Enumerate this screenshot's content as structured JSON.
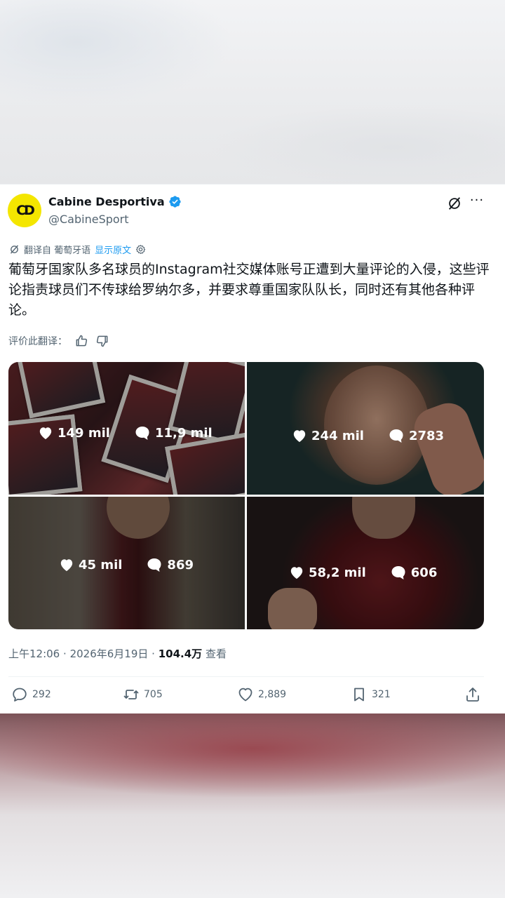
{
  "tweet": {
    "author_name": "Cabine Desportiva",
    "author_handle": "@CabineSport",
    "avatar_text": "CD",
    "verified": true,
    "translated_from": "翻译自 葡萄牙语",
    "show_original": "显示原文",
    "text": "葡萄牙国家队多名球员的Instagram社交媒体账号正遭到大量评论的入侵，这些评论指责球员们不传球给罗纳尔多，并要求尊重国家队队长，同时还有其他各种评论。",
    "rate_translation": "评价此翻译：",
    "time": "上午12:06",
    "date": "2026年6月19日",
    "views": "104.4万",
    "views_label": "查看",
    "dot": "·"
  },
  "media": [
    {
      "likes": "149 mil",
      "comments": "11,9 mil"
    },
    {
      "likes": "244 mil",
      "comments": "2783"
    },
    {
      "likes": "45 mil",
      "comments": "869"
    },
    {
      "likes": "58,2 mil",
      "comments": "606"
    }
  ],
  "actions": {
    "replies": "292",
    "reposts": "705",
    "likes": "2,889",
    "bookmarks": "321"
  },
  "colors": {
    "accent": "#1d9bf0",
    "text": "#0f1419",
    "muted": "#536471",
    "avatar_bg": "#f4e600"
  }
}
